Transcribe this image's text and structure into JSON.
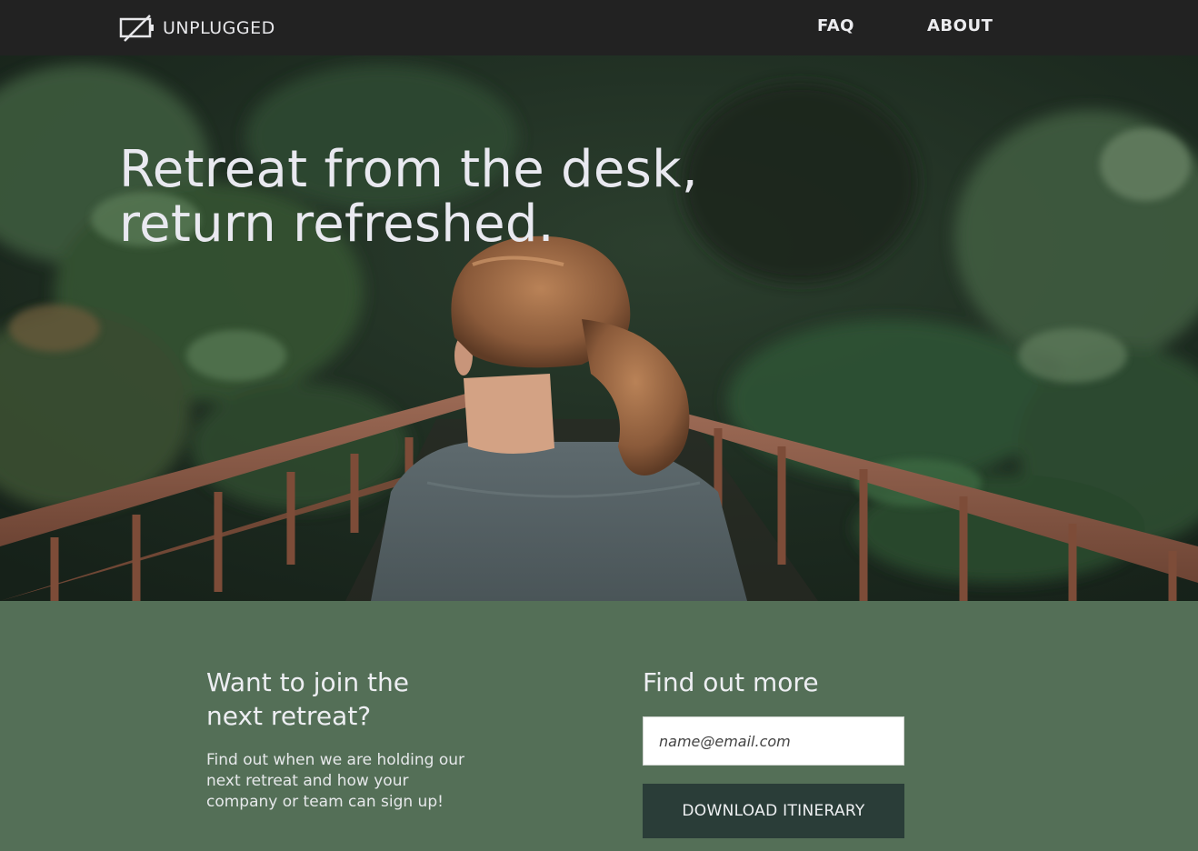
{
  "nav": {
    "logo_text": "UNPLUGGED",
    "logo_icon": "unplugged-screen-icon",
    "links": [
      {
        "label": "FAQ"
      },
      {
        "label": "ABOUT"
      }
    ]
  },
  "hero": {
    "headline_line1": "Retreat from the desk,",
    "headline_line2": "return refreshed.",
    "image_description_icon": "forest-bridge-photo"
  },
  "join": {
    "title_line1": "Want to join the",
    "title_line2": "next retreat?",
    "desc_line1": "Find out when we are holding our",
    "desc_line2": "next retreat and how your",
    "desc_line3": "company or team can sign up!"
  },
  "signup": {
    "title": "Find out more",
    "email_placeholder": "name@email.com",
    "button_label": "DOWNLOAD ITINERARY"
  },
  "colors": {
    "nav_bg": "#222222",
    "section_bg": "#546f57",
    "button_bg": "#2a3d38",
    "text_light": "#edeef2"
  }
}
